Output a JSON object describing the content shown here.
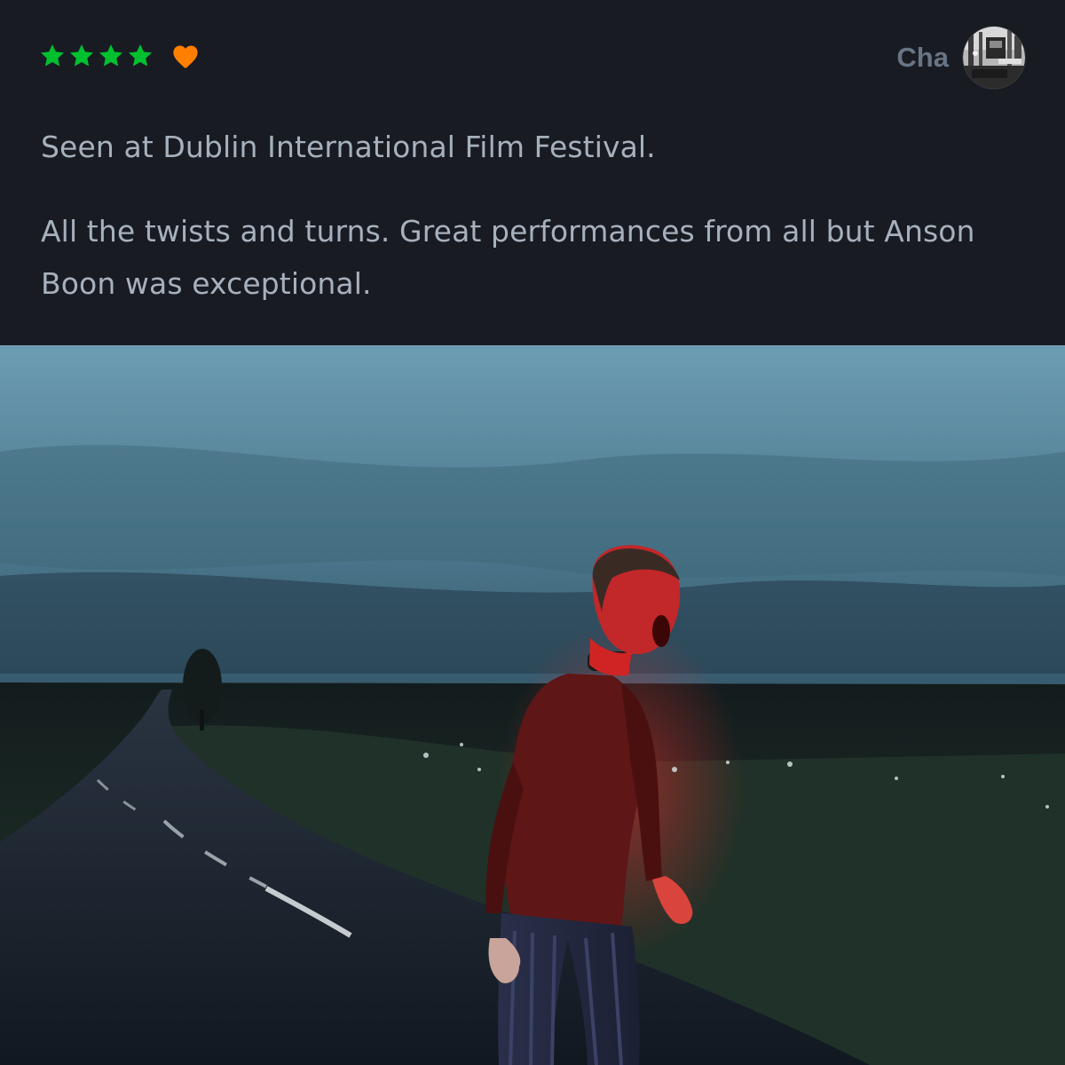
{
  "review": {
    "rating_stars": 4,
    "liked": true,
    "star_color": "#00c030",
    "heart_color": "#ff8000",
    "paragraphs": [
      "Seen at Dublin International Film Festival.",
      "All the twists and turns. Great performances from all but Anson Boon was exceptional."
    ]
  },
  "user": {
    "name": "Cha",
    "avatar_icon": "avatar-photo"
  },
  "still": {
    "icon": "film-still-image"
  }
}
